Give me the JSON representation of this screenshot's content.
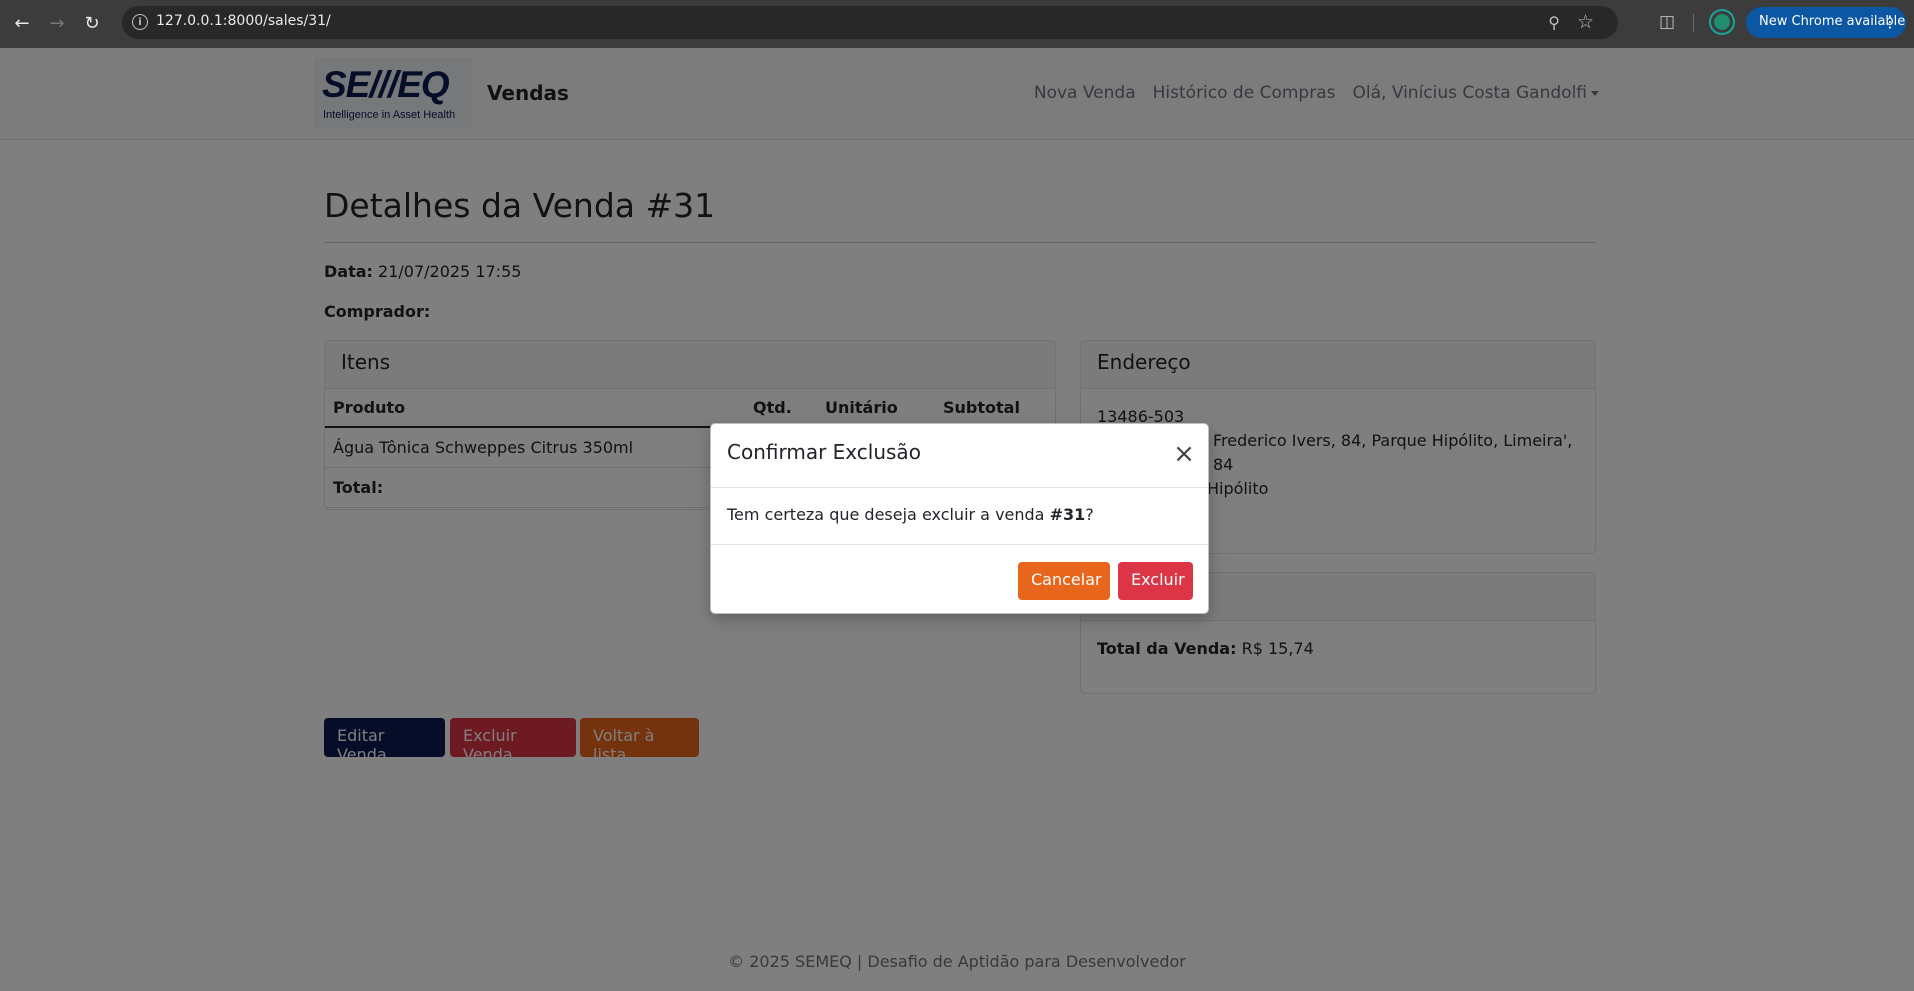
{
  "browser": {
    "url": "127.0.0.1:8000/sales/31/",
    "update_label": "New Chrome available"
  },
  "navbar": {
    "logo_text": "SE///EQ",
    "logo_tagline": "Intelligence in Asset Health",
    "title": "Vendas",
    "links": [
      "Nova Venda",
      "Histórico de Compras",
      "Olá, Vinícius Costa Gandolfi"
    ]
  },
  "sale": {
    "title": "Detalhes da Venda #31",
    "date_label": "Data:",
    "date_value": "21/07/2025 17:55",
    "buyer_label": "Comprador:",
    "buyer_value": ""
  },
  "items": {
    "header": "Itens",
    "columns": [
      "Produto",
      "Qtd.",
      "Unitário",
      "Subtotal"
    ],
    "rows": [
      {
        "product": "Água Tônica Schweppes Citrus 350ml"
      }
    ],
    "total_label": "Total:"
  },
  "address": {
    "header": "Endereço",
    "cep": "13486-503",
    "line1": "Frederico Ivers, 84, Parque Hipólito, Limeira', 84",
    "line2": "Hipólito"
  },
  "summary": {
    "total_label": "Total da Venda:",
    "total_value": "R$ 15,74"
  },
  "actions": {
    "edit": "Editar Venda",
    "delete": "Excluir Venda",
    "back": "Voltar à lista"
  },
  "footer": "© 2025 SEMEQ | Desafio de Aptidão para Desenvolvedor",
  "modal": {
    "title": "Confirmar Exclusão",
    "body_prefix": "Tem certeza que deseja excluir a venda ",
    "body_ref": "#31",
    "body_suffix": "?",
    "cancel": "Cancelar",
    "confirm": "Excluir"
  },
  "colors": {
    "brand_navy": "#0d1b52",
    "danger": "#dc3545",
    "orange": "#e8661b"
  }
}
